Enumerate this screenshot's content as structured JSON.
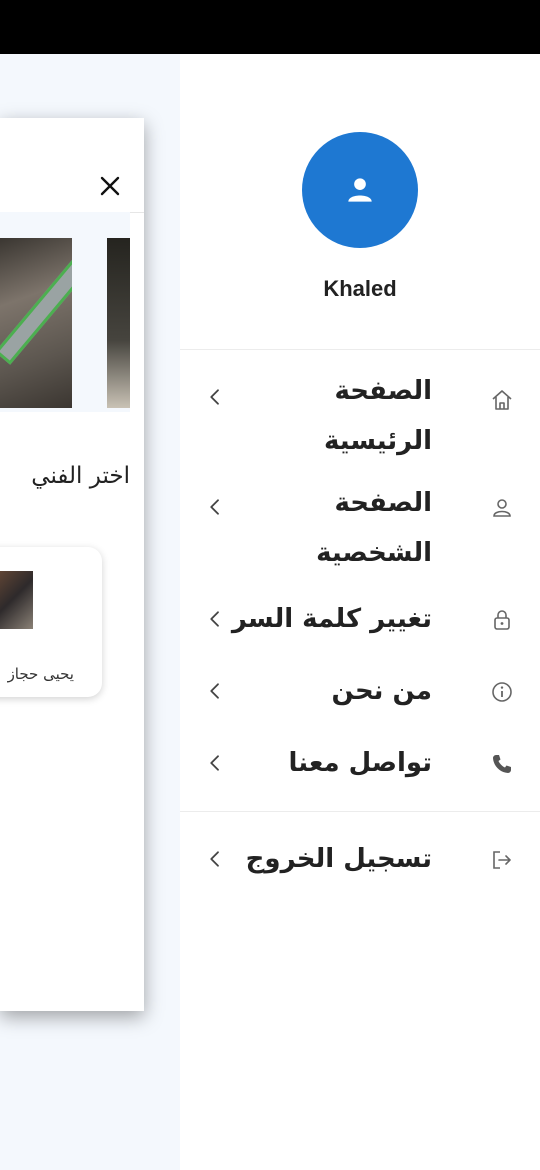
{
  "drawer": {
    "user_name": "Khaled",
    "menu": [
      {
        "label_line1": "الصفحة",
        "label_line2": "الرئيسية",
        "icon": "home-icon"
      },
      {
        "label_line1": "الصفحة",
        "label_line2": "الشخصية",
        "icon": "person-icon"
      },
      {
        "label_line1": "تغيير كلمة السر",
        "icon": "lock-icon"
      },
      {
        "label_line1": "من نحن",
        "icon": "info-icon"
      },
      {
        "label_line1": "تواصل معنا",
        "icon": "phone-icon"
      },
      {
        "label_line1": "تسجيل الخروج",
        "icon": "logout-icon"
      }
    ]
  },
  "background_page": {
    "section_title": "اختر الفني",
    "worker_name": "يحيى حجاز"
  },
  "colors": {
    "avatar": "#1e78d2",
    "status_bar": "#000000",
    "page_bg": "#f4f8fd"
  }
}
